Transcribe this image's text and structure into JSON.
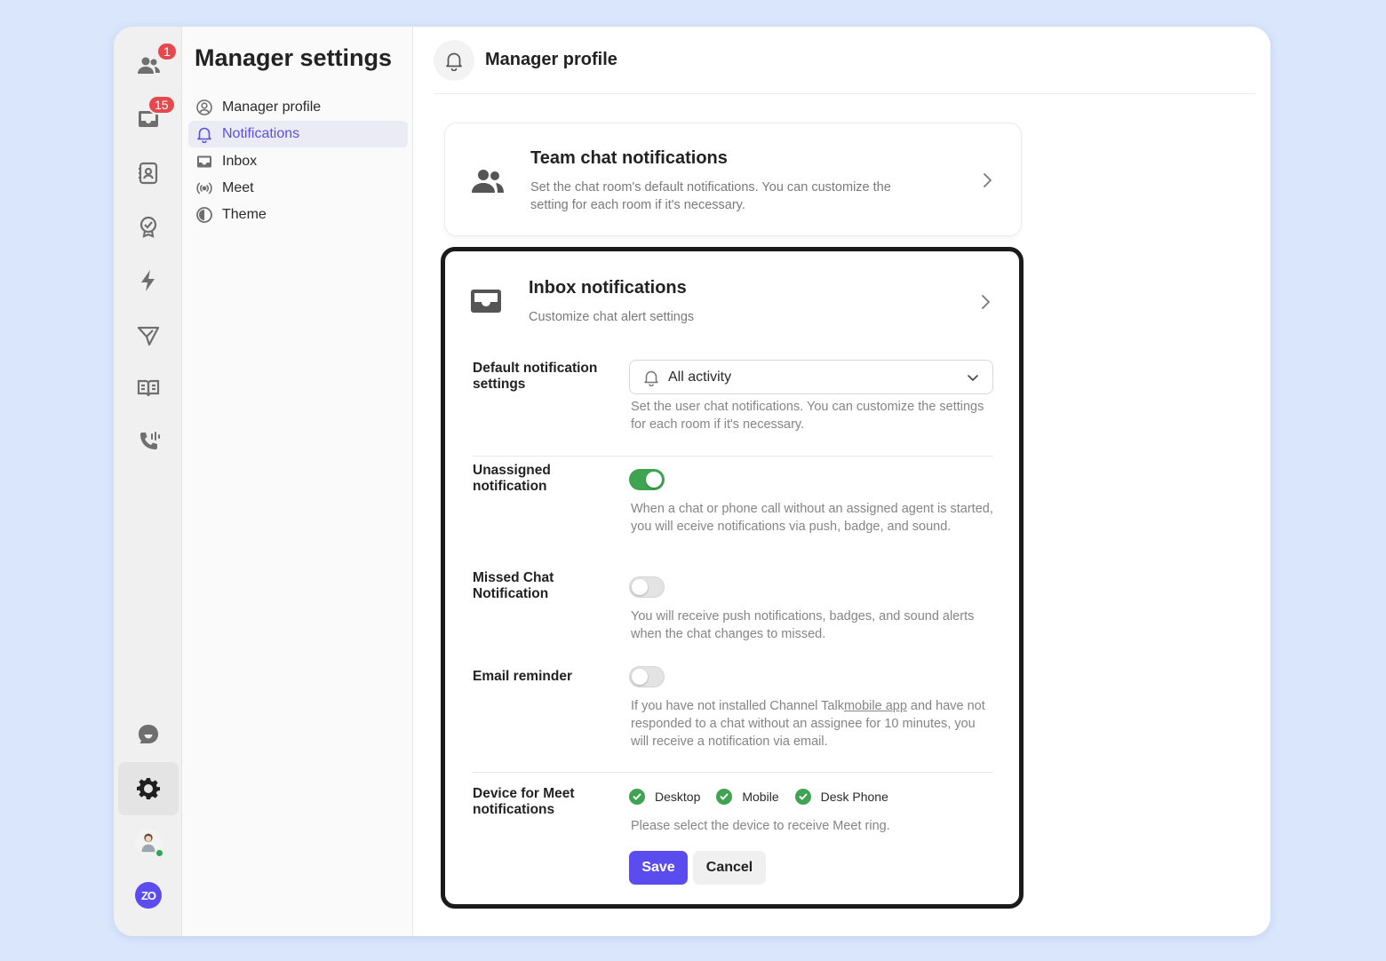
{
  "rail": {
    "items": [
      {
        "icon": "team-icon",
        "badge": "1"
      },
      {
        "icon": "inbox-icon",
        "badge": "15"
      },
      {
        "icon": "contacts-icon",
        "badge": null
      },
      {
        "icon": "badge-check-icon",
        "badge": null
      },
      {
        "icon": "lightning-icon",
        "badge": null
      },
      {
        "icon": "send-icon",
        "badge": null
      },
      {
        "icon": "book-icon",
        "badge": null
      },
      {
        "icon": "phone-icon",
        "badge": null
      },
      {
        "icon": "chat-bubble-icon",
        "badge": null
      },
      {
        "icon": "gear-icon",
        "badge": null,
        "active": true
      }
    ],
    "logo_text": "ZO"
  },
  "settings": {
    "title": "Manager settings",
    "nav": [
      {
        "label": "Manager profile",
        "icon": "user-circle-icon"
      },
      {
        "label": "Notifications",
        "icon": "bell-icon",
        "active": true
      },
      {
        "label": "Inbox",
        "icon": "inbox-icon"
      },
      {
        "label": "Meet",
        "icon": "broadcast-icon"
      },
      {
        "label": "Theme",
        "icon": "theme-icon"
      }
    ]
  },
  "header": {
    "title": "Manager profile"
  },
  "team_card": {
    "title": "Team chat notifications",
    "desc": "Set the chat room's default notifications. You can customize the setting for each room if it's necessary."
  },
  "inbox_card": {
    "title": "Inbox notifications",
    "desc": "Customize chat alert settings",
    "default_label": "Default notification settings",
    "default_value": "All activity",
    "default_help": "Set the user chat notifications. You can customize the settings for each room if it's necessary.",
    "unassigned_label": "Unassigned notification",
    "unassigned_on": true,
    "unassigned_help": "When a chat or phone call without an assigned agent is started, you will eceive notifications via push, badge, and sound.",
    "missed_label": "Missed Chat Notification",
    "missed_on": false,
    "missed_help": "You will receive push notifications, badges, and sound alerts when the chat changes to missed.",
    "email_label": "Email reminder",
    "email_on": false,
    "email_help_before": "If you have not installed Channel Talk",
    "email_help_link": "mobile app",
    "email_help_after": " and have not responded to a chat without an assignee for 10 minutes, you will receive a notification via email.",
    "meet_label": "Device for Meet notifications",
    "devices": [
      "Desktop",
      "Mobile",
      "Desk Phone"
    ],
    "meet_help": "Please select the device to receive Meet ring.",
    "save_label": "Save",
    "cancel_label": "Cancel"
  },
  "colors": {
    "accent": "#5b4cf0",
    "toggle_on": "#3fa451",
    "badge": "#e5484d"
  }
}
